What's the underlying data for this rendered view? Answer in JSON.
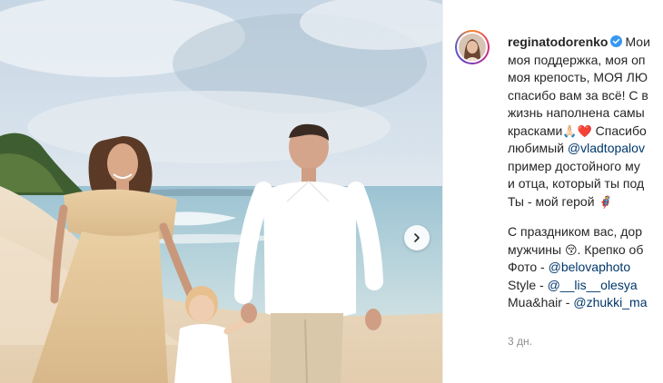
{
  "post": {
    "username": "reginatodorenko",
    "caption_lines": [
      "Мои",
      "моя поддержка, моя оп",
      "моя крепость, МОЯ ЛЮ",
      "спасибо вам за всё! С в",
      "жизнь наполнена самы",
      "красками",
      "Спасибо",
      "любимый",
      "@vladtopalov",
      "пример достойного му",
      "и отца, который ты под",
      "Ты - мой герой",
      "С праздником вас, дор",
      "мужчины",
      ". Крепко об",
      "Фото - ",
      "@belovaphoto",
      "Style - ",
      "@__lis__olesya",
      "Mua&hair - ",
      "@zhukki_ma"
    ],
    "emojis": {
      "pray": "🙏🏻",
      "heart": "❤️",
      "hero": "🦸",
      "kiss": "😚"
    },
    "timestamp": "3 дн."
  },
  "icons": {
    "verified": "verified-badge-icon",
    "next": "chevron-right-icon"
  },
  "colors": {
    "verified": "#3897f0",
    "mention": "#00376b",
    "text": "#262626",
    "muted": "#8e8e8e"
  }
}
